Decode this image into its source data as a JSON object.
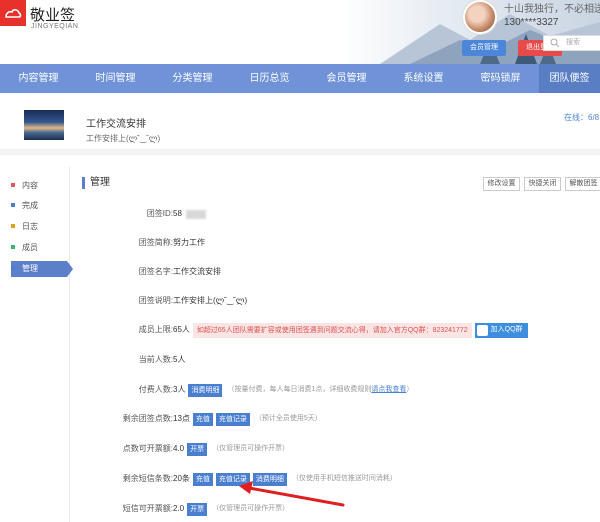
{
  "header": {
    "app_name": "敬业签",
    "app_sub": "JINGYEQIAN",
    "motto": "十山我独行，不必相送",
    "phone": "130****3327",
    "member_button": "会员管理",
    "logout_button": "退出登录"
  },
  "nav": {
    "items": [
      {
        "label": "内容管理",
        "active": false
      },
      {
        "label": "时间管理",
        "active": false
      },
      {
        "label": "分类管理",
        "active": false
      },
      {
        "label": "日历总览",
        "active": false
      },
      {
        "label": "会员管理",
        "active": false
      },
      {
        "label": "系统设置",
        "active": false
      },
      {
        "label": "密码锁屏",
        "active": false
      },
      {
        "label": "团队便签",
        "active": true
      }
    ]
  },
  "group": {
    "title": "工作交流安排",
    "desc": "工作安排上(ლ˘‿˘ლ)",
    "online": "在线：6/8",
    "search_placeholder": "搜索"
  },
  "sidebar": {
    "items": [
      {
        "label": "内容",
        "color": "#e05a5a"
      },
      {
        "label": "完成",
        "color": "#4a7fd0"
      },
      {
        "label": "日志",
        "color": "#e0a020"
      },
      {
        "label": "成员",
        "color": "#3cb371"
      },
      {
        "label": "管理",
        "color": "#4a7fd0"
      }
    ]
  },
  "main": {
    "section_title": "管理",
    "buttons": {
      "edit": "修改设置",
      "quick_close": "快捷关闭",
      "dissolve": "解散团签"
    },
    "rows": {
      "id": {
        "label": "团签ID:",
        "value": "58"
      },
      "short_name": {
        "label": "团签简称:",
        "value": "努力工作"
      },
      "name": {
        "label": "团签名字:",
        "value": "工作交流安排"
      },
      "desc": {
        "label": "团签说明:",
        "value": "工作安排上(ლ˘‿˘ლ)"
      },
      "limit": {
        "label": "成员上限:",
        "value": "65人",
        "warn": "如超过65人团队需要扩容或使用团签遇到问题交流心得，请加入官方QQ群：823241772",
        "qq_button": "加入QQ群"
      },
      "current": {
        "label": "当前人数:",
        "value": "5人"
      },
      "paid": {
        "label": "付费人数:",
        "value": "3人",
        "tag": "消费明细",
        "hint": "（按量付费，每人每日消费1点，详细收费规则",
        "hint_link": "请点我查看",
        "hint_end": "）"
      },
      "points": {
        "label": "剩余团签点数:",
        "value": "13点",
        "tag1": "充值",
        "tag2": "充值记录",
        "hint": "（预计全员使用5天）"
      },
      "points_invoice": {
        "label": "点数可开票额:",
        "value": "4.0",
        "tag": "开票",
        "hint": "（仅管理员可操作开票）"
      },
      "sms": {
        "label": "剩余短信条数:",
        "value": "20条",
        "tag1": "充值",
        "tag2": "充值记录",
        "tag3": "消费明细",
        "hint": "（仅使用手机短信推送时间消耗）"
      },
      "sms_invoice": {
        "label": "短信可开票额:",
        "value": "2.0",
        "tag": "开票",
        "hint": "（仅管理员可操作开票）"
      }
    }
  },
  "colors": {
    "nav": "#6f93d6",
    "accent": "#4a7fd0",
    "danger": "#e84a4a",
    "annotation_arrow": "#e02020"
  }
}
